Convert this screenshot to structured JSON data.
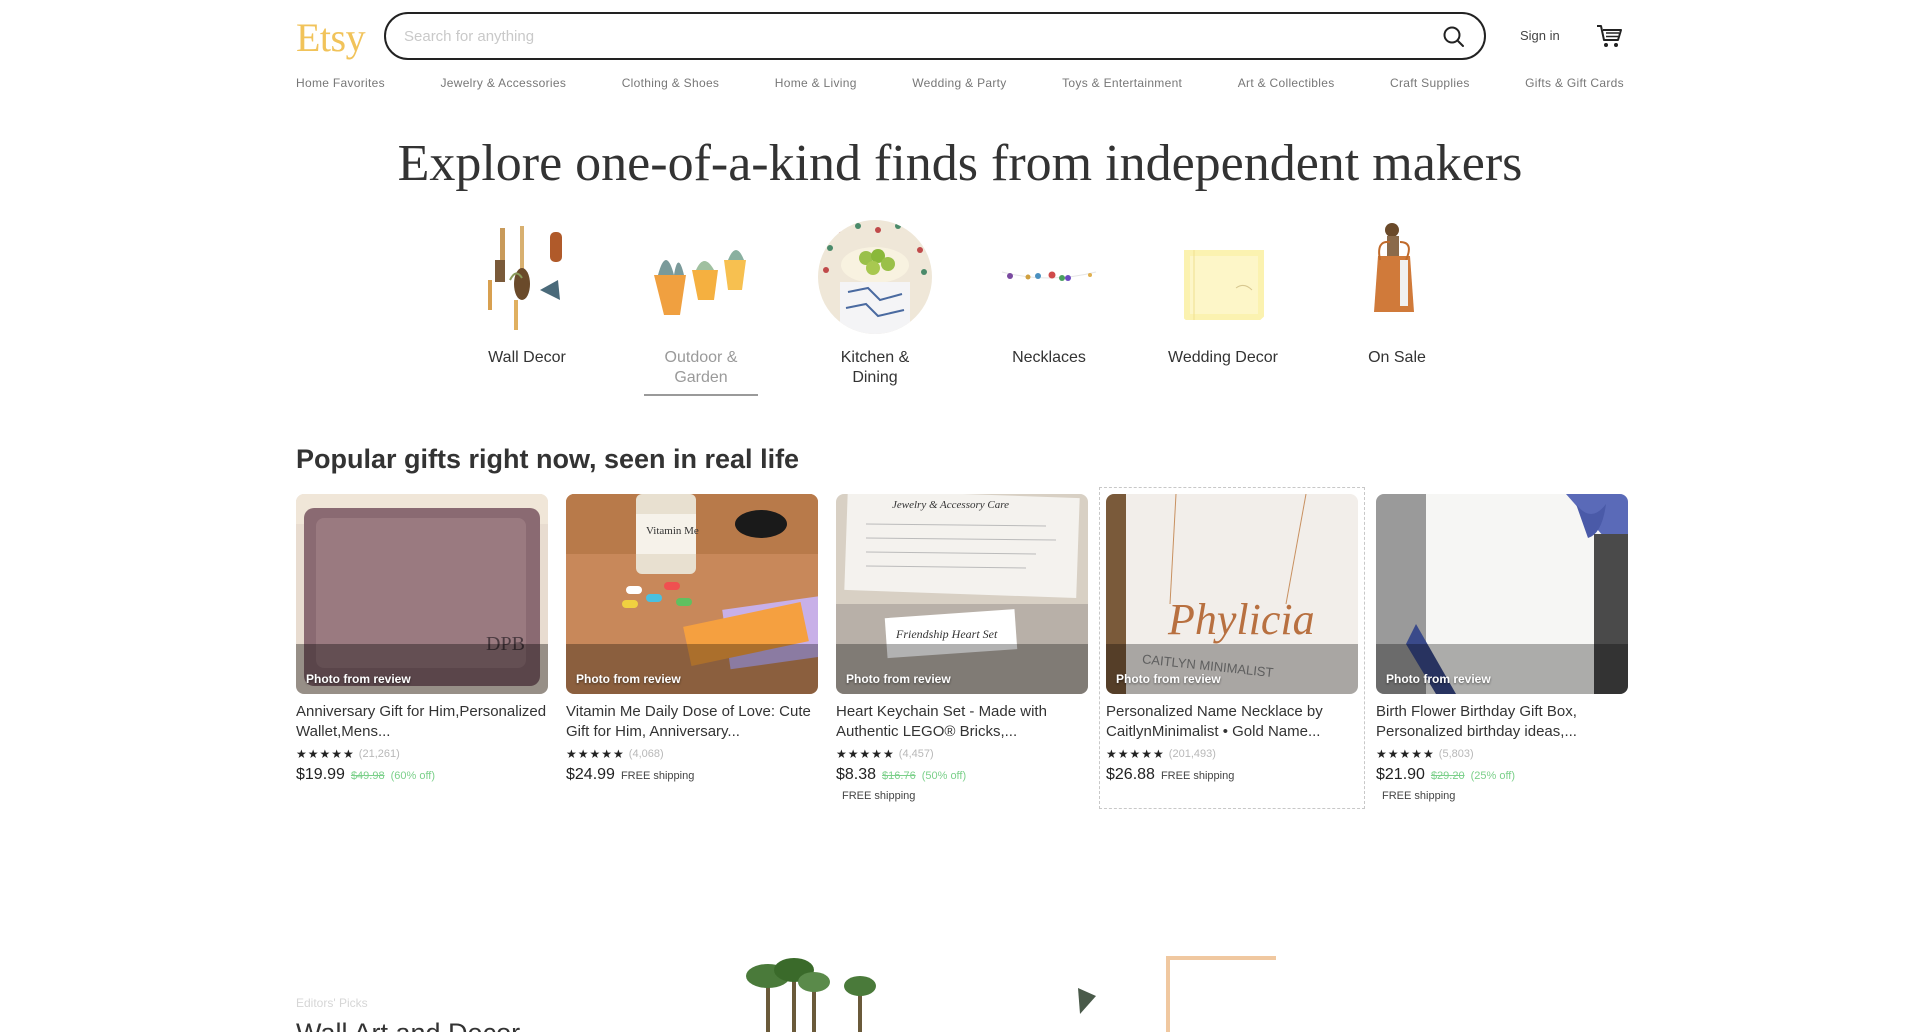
{
  "header": {
    "logo": "Etsy",
    "search_placeholder": "Search for anything",
    "sign_in": "Sign in"
  },
  "nav": [
    "Home Favorites",
    "Jewelry & Accessories",
    "Clothing & Shoes",
    "Home & Living",
    "Wedding & Party",
    "Toys & Entertainment",
    "Art & Collectibles",
    "Craft Supplies",
    "Gifts & Gift Cards"
  ],
  "hero": "Explore one-of-a-kind finds from independent makers",
  "categories": [
    {
      "label": "Wall Decor"
    },
    {
      "label": "Outdoor & Garden"
    },
    {
      "label": "Kitchen & Dining"
    },
    {
      "label": "Necklaces"
    },
    {
      "label": "Wedding Decor"
    },
    {
      "label": "On Sale"
    }
  ],
  "section_title": "Popular gifts right now, seen in real life",
  "cards": [
    {
      "tag": "Photo from review",
      "title": "Anniversary Gift for Him,Personalized Wallet,Mens...",
      "stars": "★★★★★",
      "reviews": "(21,261)",
      "price": "$19.99",
      "original": "$49.98",
      "discount": "(60% off)",
      "shipping": ""
    },
    {
      "tag": "Photo from review",
      "title": "Vitamin Me Daily Dose of Love: Cute Gift for Him, Anniversary...",
      "stars": "★★★★★",
      "reviews": "(4,068)",
      "price": "$24.99",
      "original": "",
      "discount": "",
      "shipping": "FREE shipping"
    },
    {
      "tag": "Photo from review",
      "title": "Heart Keychain Set - Made with Authentic LEGO® Bricks,...",
      "stars": "★★★★★",
      "reviews": "(4,457)",
      "price": "$8.38",
      "original": "$16.76",
      "discount": "(50% off)",
      "shipping": "FREE shipping"
    },
    {
      "tag": "Photo from review",
      "title": "Personalized Name Necklace by CaitlynMinimalist • Gold Name...",
      "stars": "★★★★★",
      "reviews": "(201,493)",
      "price": "$26.88",
      "original": "",
      "discount": "",
      "shipping": "FREE shipping"
    },
    {
      "tag": "Photo from review",
      "title": "Birth Flower Birthday Gift Box, Personalized birthday ideas,...",
      "stars": "★★★★★",
      "reviews": "(5,803)",
      "price": "$21.90",
      "original": "$29.20",
      "discount": "(25% off)",
      "shipping": "FREE shipping"
    }
  ],
  "editors_picks": {
    "label": "Editors' Picks",
    "title": "Wall Art and Decor"
  },
  "colors": {
    "logo": "#f1c35a",
    "discount": "#7bd08a"
  }
}
